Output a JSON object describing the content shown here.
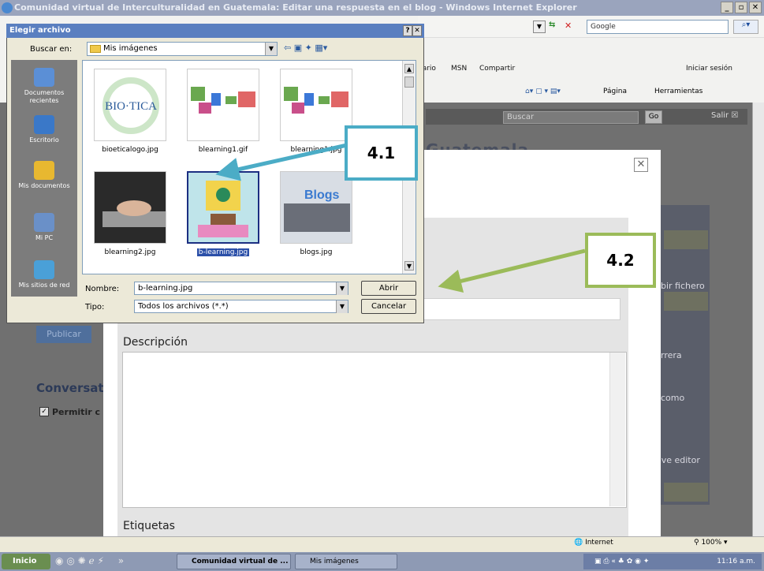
{
  "browser": {
    "title": "Comunidad virtual de Interculturalidad en Guatemala: Editar una respuesta en el blog - Windows Internet Explorer",
    "search_placeholder": "Google",
    "links": [
      "dario",
      "MSN",
      "Compartir"
    ],
    "login": "Iniciar sesión",
    "tools": [
      "Página",
      "Herramientas"
    ]
  },
  "site": {
    "search_placeholder": "Buscar",
    "go_label": "Go",
    "logout": "Salir",
    "heading_partial": "Guatemala",
    "bg_subir": "bir fichero",
    "bg_rrera": "rrera",
    "bg_como": "como",
    "bg_editor": "ove editor",
    "publicar": "Publicar",
    "conversat": "Conversat",
    "permitir": "Permitir c"
  },
  "modal": {
    "descripcion_label": "Descripción",
    "etiquetas_label": "Etiquetas"
  },
  "dialog": {
    "title": "Elegir archivo",
    "buscar_label": "Buscar en:",
    "location": "Mis imágenes",
    "places": [
      {
        "label": "Documentos recientes",
        "icon": "recent-documents-icon",
        "color": "#5b8fd6"
      },
      {
        "label": "Escritorio",
        "icon": "desktop-icon",
        "color": "#3a78c8"
      },
      {
        "label": "Mis documentos",
        "icon": "my-documents-icon",
        "color": "#e8b830"
      },
      {
        "label": "Mi PC",
        "icon": "my-computer-icon",
        "color": "#6a90c8"
      },
      {
        "label": "Mis sitios de red",
        "icon": "network-places-icon",
        "color": "#4aa0d8"
      }
    ],
    "files": [
      {
        "name": "bioeticalogo.jpg",
        "selected": false
      },
      {
        "name": "blearning1.gif",
        "selected": false
      },
      {
        "name": "blearning1.jpg",
        "selected": false
      },
      {
        "name": "blearning2.jpg",
        "selected": false
      },
      {
        "name": "b-learning.jpg",
        "selected": true
      },
      {
        "name": "blogs.jpg",
        "selected": false
      }
    ],
    "nombre_label": "Nombre:",
    "nombre_value": "b-learning.jpg",
    "tipo_label": "Tipo:",
    "tipo_value": "Todos los archivos (*.*)",
    "abrir_label": "Abrir",
    "cancelar_label": "Cancelar"
  },
  "callouts": {
    "c1": "4.1",
    "c2": "4.2",
    "color1": "#4bacc6",
    "color2": "#9bbb59"
  },
  "statusbar": {
    "zone": "Internet",
    "zoom": "100%"
  },
  "taskbar": {
    "start": "Inicio",
    "task1": "Comunidad virtual de ...",
    "task2": "Mis imágenes",
    "time": "11:16 a.m."
  }
}
